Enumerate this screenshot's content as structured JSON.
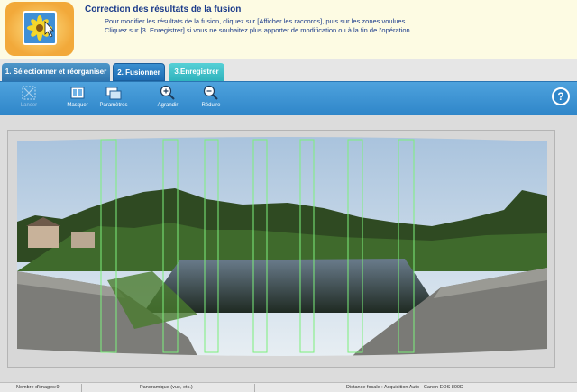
{
  "header": {
    "title": "Correction des résultats de la fusion",
    "line1": "Pour modifier les résultats de la fusion, cliquez sur [Afficher les raccords], puis sur les zones voulues.",
    "line2": "Cliquez sur [3. Enregistrer] si vous ne souhaitez plus apporter de modification ou à la fin de l'opération."
  },
  "tabs": [
    {
      "label": "1. Sélectionner et réorganiser"
    },
    {
      "label": "2. Fusionner"
    },
    {
      "label": "3.Enregistrer"
    }
  ],
  "toolbar": {
    "lancer": "Lancer",
    "masquer": "Masquer",
    "parametres": "Paramètres",
    "agrandir": "Agrandir",
    "reduire": "Réduire",
    "help": "?"
  },
  "status": {
    "images": "Nombre d'images:9",
    "mode": "Panoramique (vue, etc.)",
    "info": "Distance focale : Acquisition Auto - Canon EOS 800D"
  },
  "colors": {
    "accent": "#2f86c9",
    "seam": "#7cf07c",
    "header_text": "#1a3a8a"
  }
}
